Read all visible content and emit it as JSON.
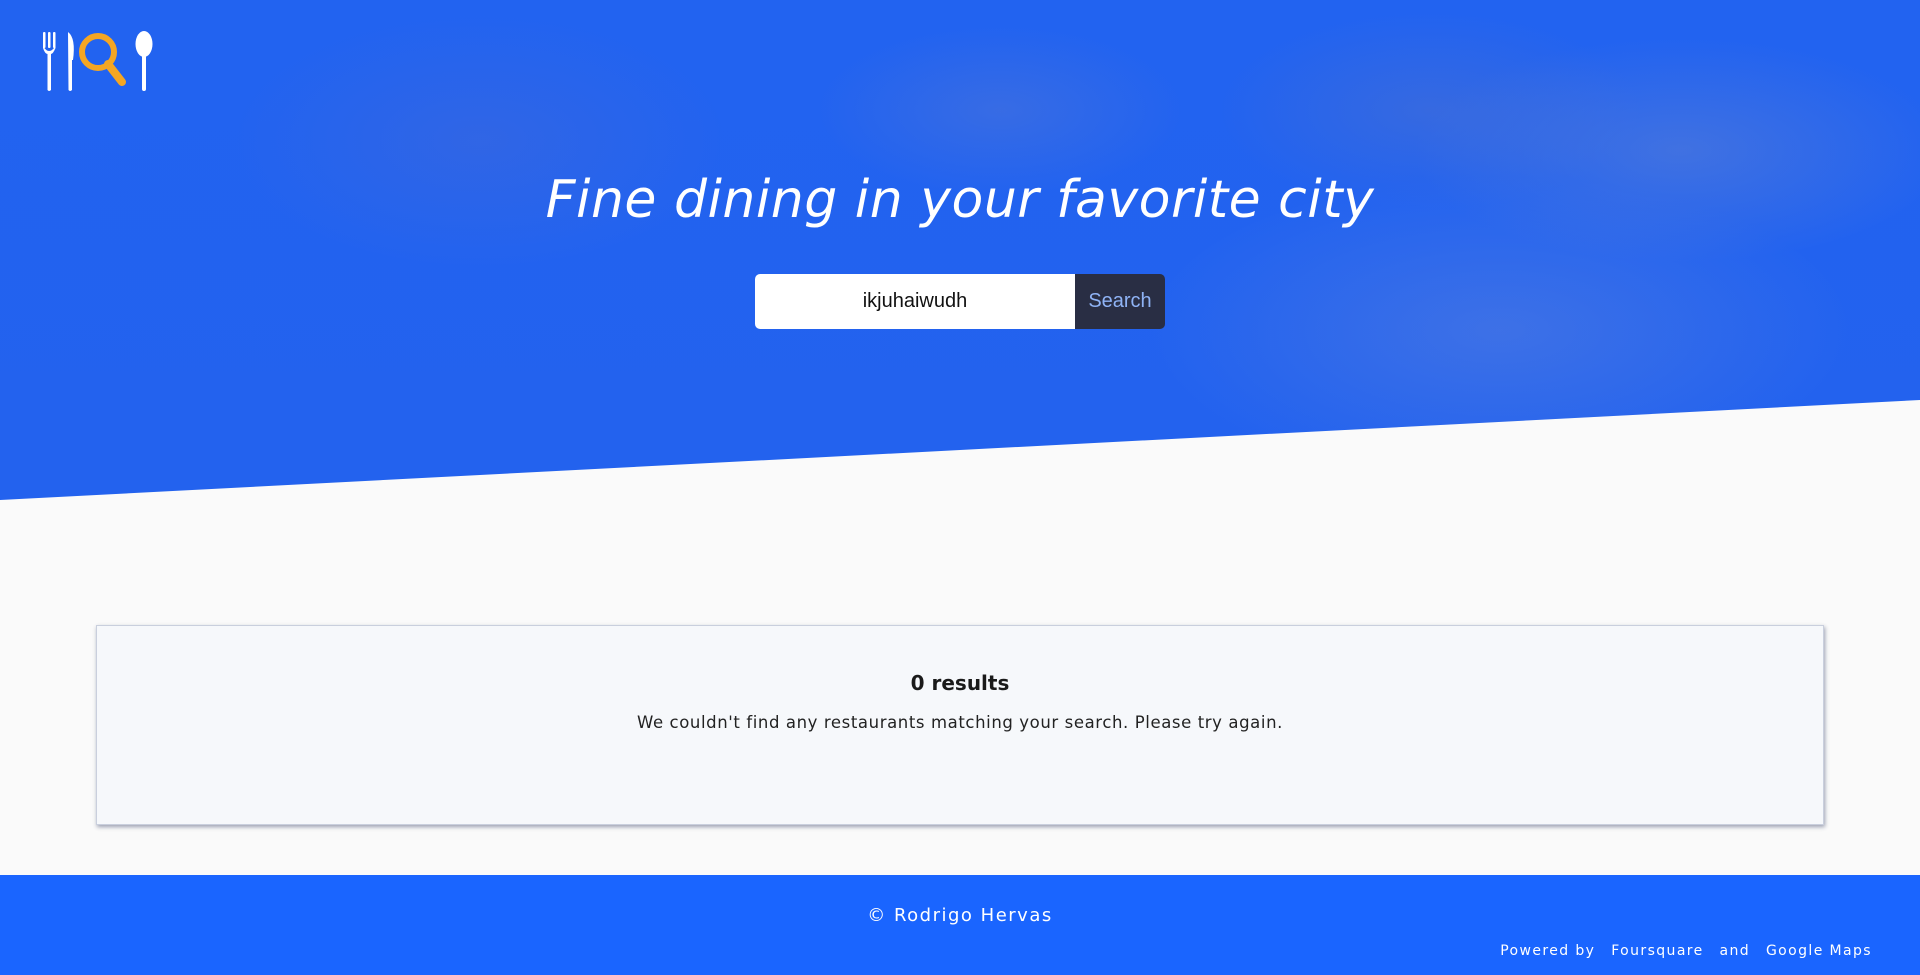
{
  "header": {
    "logo_icon": "fork-knife-magnifier-spoon-icon"
  },
  "hero": {
    "headline": "Fine dining in your favorite city"
  },
  "search": {
    "value": "ikjuhaiwudh",
    "button_label": "Search"
  },
  "results": {
    "count_label": "0 results",
    "message": "We couldn't find any restaurants matching your search. Please try again."
  },
  "footer": {
    "copyright": "© Rodrigo Hervas",
    "powered_by": "Powered by",
    "provider_1": "Foursquare",
    "and": "and",
    "provider_2": "Google Maps"
  },
  "colors": {
    "hero_blue": "#2263f0",
    "footer_blue": "#1a65ff",
    "logo_accent": "#f5a623",
    "search_button_bg": "#292e44"
  }
}
